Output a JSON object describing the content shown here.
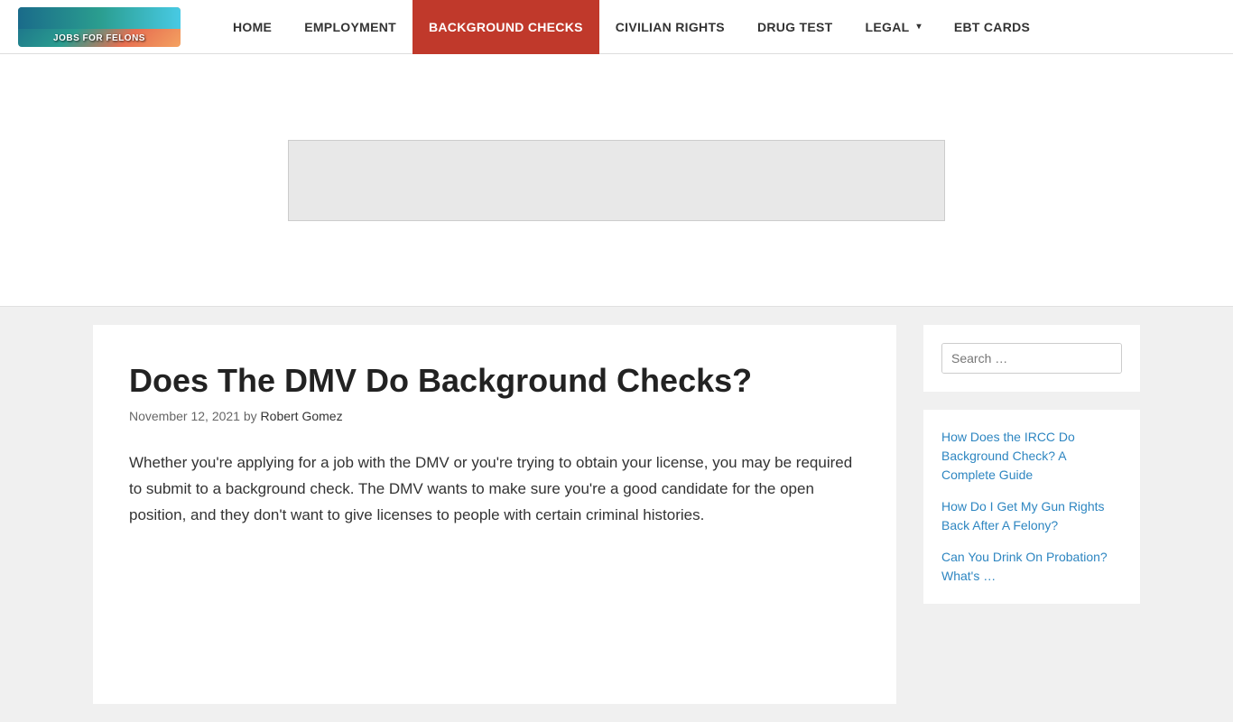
{
  "site": {
    "logo_alt": "Jobs For Felons"
  },
  "nav": {
    "items": [
      {
        "label": "HOME",
        "active": false
      },
      {
        "label": "EMPLOYMENT",
        "active": false
      },
      {
        "label": "BACKGROUND CHECKS",
        "active": true
      },
      {
        "label": "CIVILIAN RIGHTS",
        "active": false
      },
      {
        "label": "DRUG TEST",
        "active": false
      },
      {
        "label": "LEGAL",
        "active": false,
        "dropdown": true
      },
      {
        "label": "EBT CARDS",
        "active": false
      }
    ]
  },
  "article": {
    "title": "Does The DMV Do Background Checks?",
    "meta_date": "November 12, 2021",
    "meta_by": "by",
    "meta_author": "Robert Gomez",
    "body": "Whether you're applying for a job with the DMV or you're trying to obtain your license, you may be required to submit to a background check. The DMV wants to make sure you're a good candidate for the open position, and they don't want to give licenses to people with certain criminal histories."
  },
  "sidebar": {
    "search_placeholder": "Search …",
    "search_label": "Search …",
    "links": [
      {
        "label": "How Does the IRCC Do Background Check? A Complete Guide"
      },
      {
        "label": "How Do I Get My Gun Rights Back After A Felony?"
      },
      {
        "label": "Can You Drink On Probation? What's …"
      }
    ]
  }
}
